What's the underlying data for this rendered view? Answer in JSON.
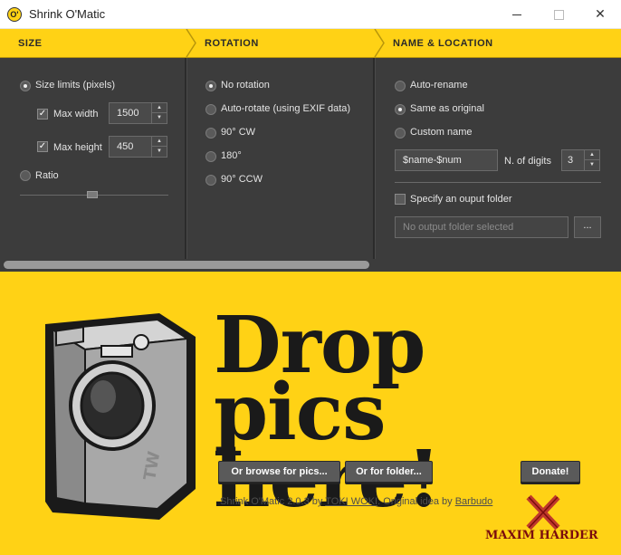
{
  "window": {
    "title": "Shrink O'Matic",
    "icon": "app-icon"
  },
  "sections": {
    "size": "SIZE",
    "rotation": "ROTATION",
    "name_location": "NAME & LOCATION"
  },
  "size": {
    "size_limits_label": "Size limits (pixels)",
    "max_width_label": "Max width",
    "max_width_value": "1500",
    "max_height_label": "Max height",
    "max_height_value": "450",
    "ratio_label": "Ratio",
    "max_width_checked": true,
    "max_height_checked": true
  },
  "rotation": {
    "options": [
      "No rotation",
      "Auto-rotate (using EXIF data)",
      "90° CW",
      "180°",
      "90° CCW"
    ],
    "selected": "No rotation"
  },
  "naming": {
    "auto_rename": "Auto-rename",
    "same_as_original": "Same as original",
    "custom_name": "Custom name",
    "selected": "Same as original",
    "pattern_value": "$name-$num",
    "digits_label": "N. of digits",
    "digits_value": "3",
    "specify_folder_label": "Specify an ouput folder",
    "folder_placeholder": "No output folder selected",
    "browse_folder_label": "..."
  },
  "drop": {
    "line1": "Drop",
    "line2": "pics here!",
    "browse_pics_button": "Or browse for pics...",
    "browse_folder_button": "Or for folder...",
    "donate_button": "Donate!"
  },
  "credits": {
    "prefix": "Shrink O'Matic 2.0.3 by ",
    "author": "TOKI WOKI",
    "middle": ". Original idea by ",
    "idea_by": "Barbudo",
    "logo_text": "MAXIM HARDER"
  },
  "colors": {
    "accent": "#ffd215",
    "panel": "#3c3c3c",
    "text_dark": "#1a1a1a"
  }
}
